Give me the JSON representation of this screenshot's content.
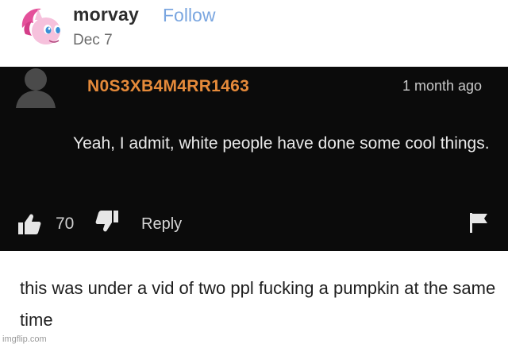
{
  "post": {
    "username": "morvay",
    "follow_label": "Follow",
    "date": "Dec 7"
  },
  "comment": {
    "author": "N0S3XB4M4RR1463",
    "time": "1 month ago",
    "text": "Yeah, I admit, white people have done some cool things.",
    "likes": "70",
    "reply_label": "Reply"
  },
  "caption": "this was under a vid of two ppl fucking a pumpkin at the same time",
  "watermark": "imgflip.com",
  "icons": {
    "avatar": "pink-pony-avatar-icon",
    "commenter_avatar": "default-user-silhouette-icon",
    "like": "thumbs-up-icon",
    "dislike": "thumbs-down-icon",
    "flag": "flag-icon"
  },
  "colors": {
    "username_accent": "#e58a3a",
    "follow_link": "#7aa6e0",
    "comment_bg": "#0b0b0b"
  }
}
